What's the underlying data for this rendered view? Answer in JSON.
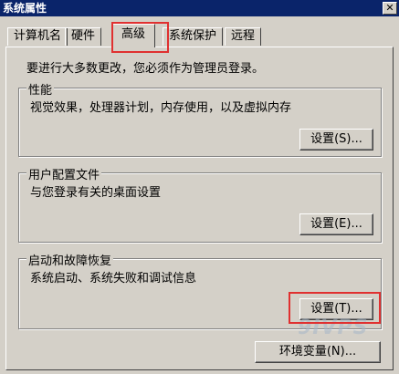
{
  "window": {
    "title": "系统属性",
    "close_icon": "✕"
  },
  "tabs": [
    {
      "label": "计算机名"
    },
    {
      "label": "硬件"
    },
    {
      "label": "高级",
      "active": true
    },
    {
      "label": "系统保护"
    },
    {
      "label": "远程"
    }
  ],
  "note": "要进行大多数更改，您必须作为管理员登录。",
  "groups": {
    "performance": {
      "title": "性能",
      "description": "视觉效果，处理器计划，内存使用，以及虚拟内存",
      "button": "设置(S)..."
    },
    "user_profiles": {
      "title": "用户配置文件",
      "description": "与您登录有关的桌面设置",
      "button": "设置(E)..."
    },
    "startup_recovery": {
      "title": "启动和故障恢复",
      "description": "系统启动、系统失败和调试信息",
      "button": "设置(T)..."
    }
  },
  "env_button": "环境变量(N)...",
  "watermark": "9IVPS",
  "highlight_color": "#e03030"
}
